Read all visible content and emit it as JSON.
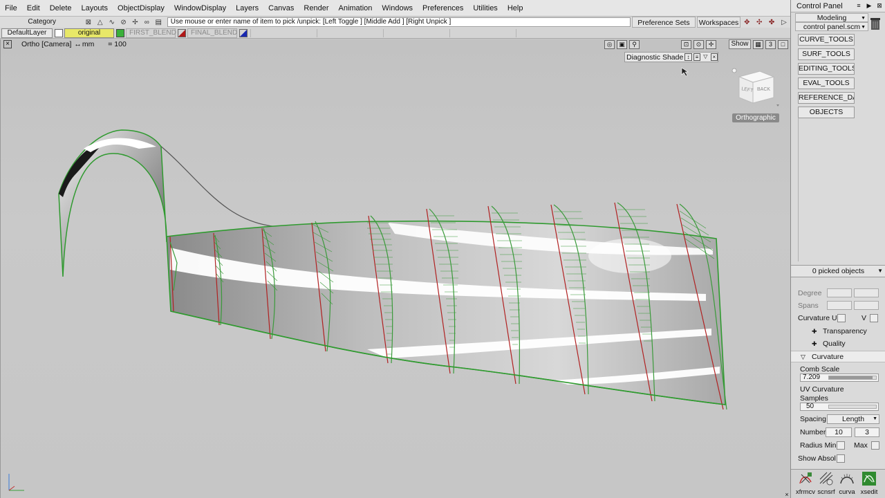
{
  "menu": [
    "File",
    "Edit",
    "Delete",
    "Layouts",
    "ObjectDisplay",
    "WindowDisplay",
    "Layers",
    "Canvas",
    "Render",
    "Animation",
    "Windows",
    "Preferences",
    "Utilities",
    "Help"
  ],
  "toolbar": {
    "category": "Category",
    "prompt": "Use mouse or enter name of item to pick /unpick: [Left Toggle ] [Middle Add ] [Right Unpick ]",
    "preference_sets": "Preference Sets",
    "workspaces": "Workspaces"
  },
  "layers": {
    "default": "DefaultLayer",
    "original": "original",
    "first_blend": "FIRST_BLEND",
    "final_blend": "FINAL_BLEND",
    "original_color": "#3ab03a",
    "first_blend_color": "#b01818",
    "final_blend_color": "#1828b0"
  },
  "viewport": {
    "title": "Ortho [Camera]",
    "units": "mm",
    "grid": "100",
    "show_button": "Show",
    "diagnostic_shade": "Diagnostic Shade",
    "viewcube_labels": [
      "LEFT",
      "BACK"
    ],
    "projection": "Orthographic",
    "icons": [
      "camera-icon",
      "screenshot-icon",
      "zoom-icon",
      "frame-icon",
      "look-icon",
      "move-icon",
      "layout-icon",
      "quad-icon",
      "max-icon"
    ]
  },
  "control_panel": {
    "title": "Control Panel",
    "mode": "Modeling",
    "file": "control panel.scm",
    "tabs": [
      "CURVE_TOOLS",
      "SURF_TOOLS",
      "EDITING_TOOLS",
      "EVAL_TOOLS",
      "REFERENCE_DATA",
      "OBJECTS"
    ],
    "picked": "0 picked objects",
    "degree_label": "Degree",
    "spans_label": "Spans",
    "curvature_u_label": "Curvature U",
    "curvature_v_label": "V",
    "sections": {
      "transparency": "Transparency",
      "quality": "Quality",
      "curvature": "Curvature"
    },
    "comb_scale_label": "Comb Scale",
    "comb_scale_value": "7.209",
    "comb_scale_fill": 0.92,
    "uv_samples_label_1": "UV Curvature",
    "uv_samples_label_2": "Samples",
    "uv_samples_value": "50",
    "uv_samples_fill": 0.0,
    "spacing_label": "Spacing",
    "spacing_value": "Length",
    "number_label": "Number",
    "number_u": "10",
    "number_v": "3",
    "radius_min_label": "Radius Min",
    "radius_max_label": "Max",
    "show_absolute_label": "Show Absol",
    "shelf": [
      {
        "label": "xfrmcv",
        "icon": "transform-cv-icon"
      },
      {
        "label": "scnsrf",
        "icon": "scan-surface-icon"
      },
      {
        "label": "curva",
        "icon": "curvature-icon"
      },
      {
        "label": "xsedit",
        "icon": "cross-section-edit-icon"
      }
    ]
  }
}
